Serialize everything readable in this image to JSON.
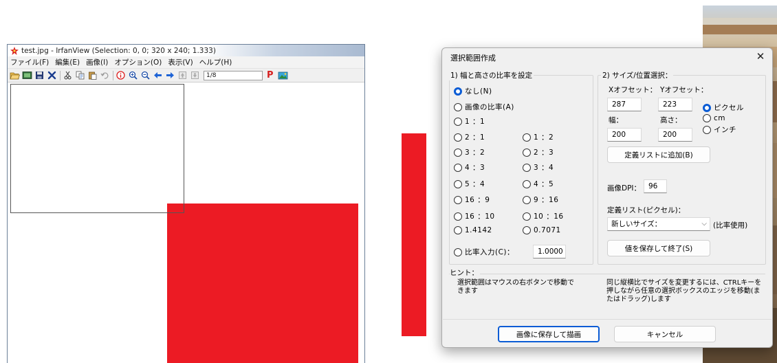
{
  "irfanview": {
    "title": "test.jpg - IrfanView (Selection: 0, 0; 320 x 240; 1.333)",
    "menu": [
      "ファイル(F)",
      "編集(E)",
      "画像(I)",
      "オプション(O)",
      "表示(V)",
      "ヘルプ(H)"
    ],
    "page_field": "1/8",
    "p_button": "P",
    "canvas_colors": {
      "red": "#ec1b24",
      "selection_border": "#555555"
    }
  },
  "dialog": {
    "title": "選択範囲作成",
    "close_label": "✕",
    "ratio_group": {
      "label": "1) 幅と高さの比率を設定",
      "selected": "なし(N)",
      "options_left": [
        "なし(N)",
        "画像の比率(A)",
        "1 ：1",
        "2 ：1",
        "3 ：2",
        "4 ：3",
        "5 ：4",
        "16 ：9",
        "16 ：10",
        "1.4142"
      ],
      "options_right": [
        "1 ：2",
        "2 ：3",
        "3 ：4",
        "4 ：5",
        "9 ：16",
        "10 ：16",
        "0.7071"
      ],
      "custom_label": "比率入力(C)：",
      "custom_value": "1.0000"
    },
    "size_group": {
      "label": "2) サイズ/位置選択：",
      "x_offset_label": "Xオフセット：",
      "y_offset_label": "Yオフセット：",
      "x_offset": "287",
      "y_offset": "223",
      "width_label": "幅：",
      "height_label": "高さ：",
      "width": "200",
      "height": "200",
      "units": [
        "ピクセル",
        "cm",
        "インチ"
      ],
      "selected_unit": "ピクセル",
      "add_button": "定義リストに追加(B)",
      "dpi_label": "画像DPI：",
      "dpi_value": "96",
      "preset_label": "定義リスト(ピクセル)：",
      "preset_value": "新しいサイズ：",
      "preset_note": "(比率使用)",
      "save_exit_button": "値を保存して終了(S)"
    },
    "hint": {
      "label": "ヒント：",
      "left": "選択範囲はマウスの右ボタンで移動できます",
      "right": "同じ縦横比でサイズを変更するには、CTRLキーを押しながら任意の選択ボックスのエッジを移動(またはドラッグ)します"
    },
    "footer": {
      "ok_button": "画像に保存して描画",
      "cancel_button": "キャンセル"
    },
    "accent_color": "#0b5cd5"
  }
}
